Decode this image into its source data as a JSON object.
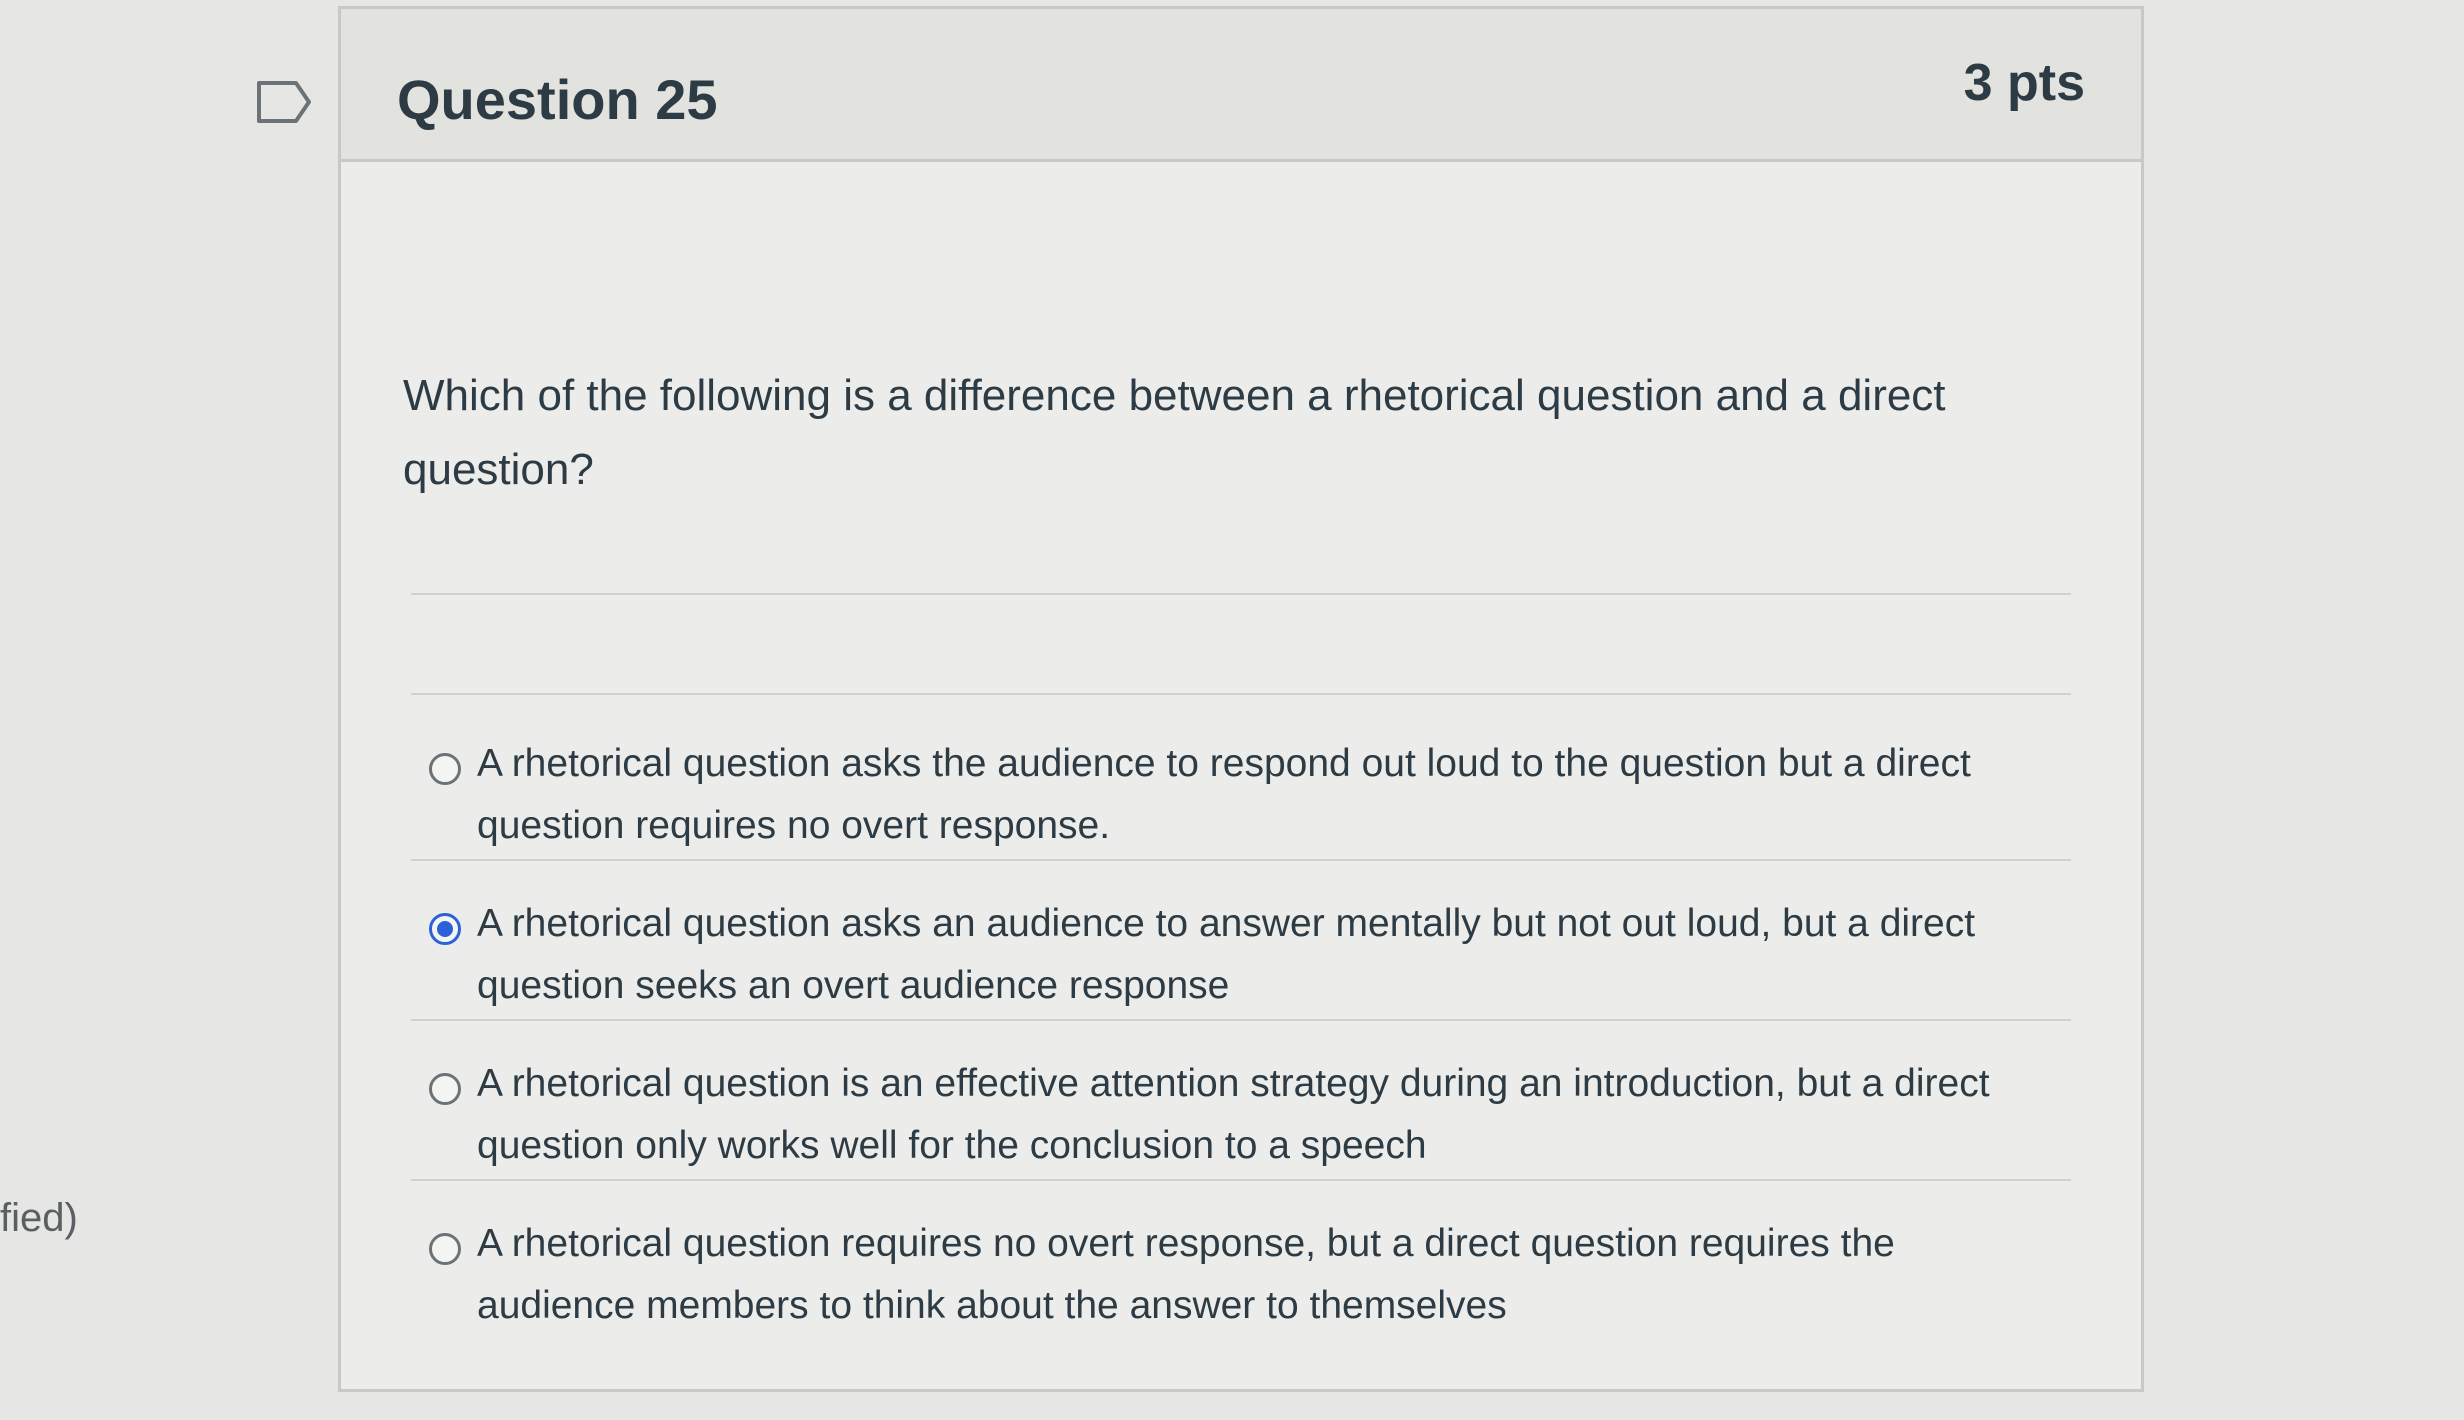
{
  "side_text": "fied)",
  "question": {
    "title": "Question 25",
    "points": "3 pts",
    "text": "Which of the following is a difference between a rhetorical question and a direct question?"
  },
  "answers": [
    {
      "label": "A rhetorical question asks the audience to respond out loud to the question but a direct question requires no overt response.",
      "selected": false
    },
    {
      "label": "A rhetorical question asks an audience to answer mentally but not out loud, but a direct question seeks an overt audience response",
      "selected": true
    },
    {
      "label": "A rhetorical question is an effective attention strategy during an introduction, but a direct question only works well for the conclusion to a speech",
      "selected": false
    },
    {
      "label": "A rhetorical question requires no overt response, but a direct question requires the audience members to think about the answer to themselves",
      "selected": false
    }
  ],
  "colors": {
    "accent": "#2b62d9",
    "text": "#2d3b45",
    "border": "#c7c9c8"
  },
  "icons": {
    "flag": "flag-icon"
  }
}
